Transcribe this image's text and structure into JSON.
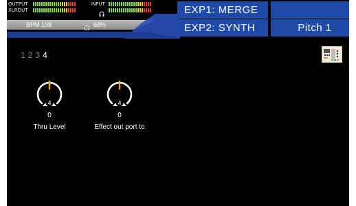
{
  "meters": {
    "output_label": "OUTPUT",
    "xlrout_label": "XLROUT",
    "input_label": "INPUT",
    "headphone_icon": "headphone-icon"
  },
  "status": {
    "bpm": "BPM 108",
    "cpu_icon": "cpu-icon",
    "cpu": "68%"
  },
  "header": {
    "exp1": "EXP1: MERGE",
    "exp2": "EXP2: SYNTH",
    "preset": "Pitch 1"
  },
  "pages": {
    "items": [
      "1",
      "2",
      "3",
      "4"
    ],
    "active_index": 3
  },
  "knobs": [
    {
      "value": "0",
      "badge": "4",
      "label": "Thru Level"
    },
    {
      "value": "0",
      "badge": "4",
      "label": "Effect out port to"
    }
  ],
  "colors": {
    "background": "#000000",
    "header_blue": "#1f4aa8",
    "knob_pointer": "#f0a21b",
    "meter_green": "#7fdc34",
    "meter_red": "#e23a2a"
  }
}
